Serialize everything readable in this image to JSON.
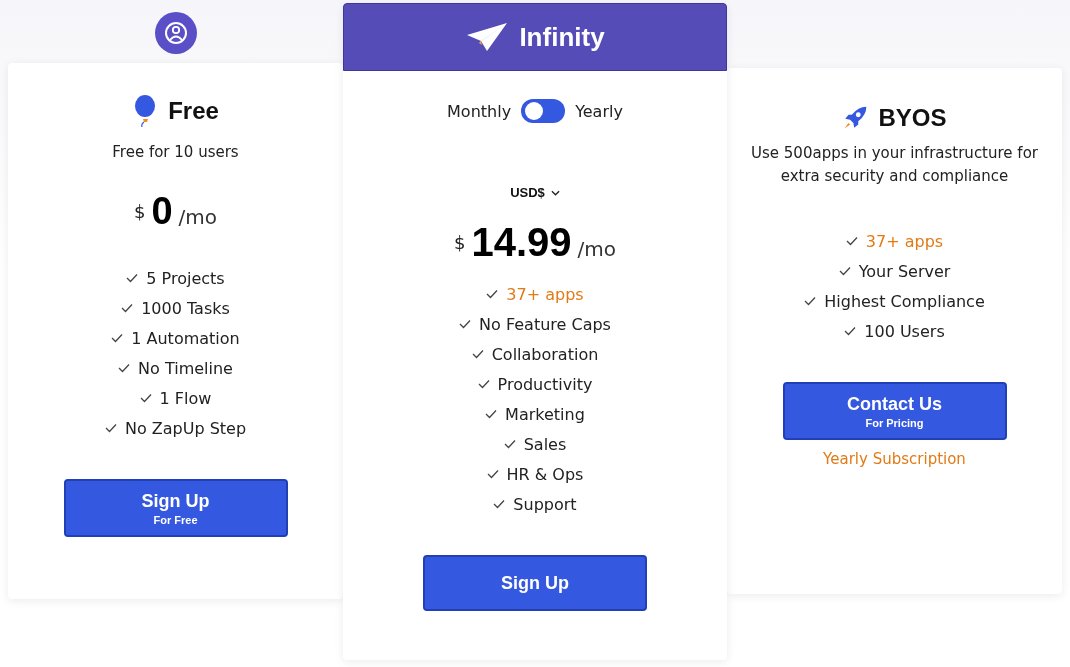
{
  "plans": [
    {
      "kind": "free",
      "name": "Free",
      "subtitle": "Free for 10 users",
      "currency_symbol": "$",
      "price": "0",
      "period": "/mo",
      "features": [
        {
          "text": "5 Projects",
          "highlighted": false
        },
        {
          "text": "1000 Tasks",
          "highlighted": false
        },
        {
          "text": "1 Automation",
          "highlighted": false
        },
        {
          "text": "No Timeline",
          "highlighted": false
        },
        {
          "text": "1 Flow",
          "highlighted": false
        },
        {
          "text": "No ZapUp Step",
          "highlighted": false
        }
      ],
      "button": {
        "label": "Sign Up",
        "sublabel": "For Free"
      }
    },
    {
      "kind": "infinity",
      "name": "Infinity",
      "toggle": {
        "left_label": "Monthly",
        "right_label": "Yearly",
        "on": false
      },
      "currency_select": "USD$",
      "currency_symbol": "$",
      "price": "14.99",
      "period": "/mo",
      "features": [
        {
          "text": "37+ apps",
          "highlighted": true
        },
        {
          "text": "No Feature Caps",
          "highlighted": false
        },
        {
          "text": "Collaboration",
          "highlighted": false
        },
        {
          "text": "Productivity",
          "highlighted": false
        },
        {
          "text": "Marketing",
          "highlighted": false
        },
        {
          "text": "Sales",
          "highlighted": false
        },
        {
          "text": "HR & Ops",
          "highlighted": false
        },
        {
          "text": "Support",
          "highlighted": false
        }
      ],
      "button": {
        "label": "Sign Up"
      }
    },
    {
      "kind": "byos",
      "name": "BYOS",
      "subtitle": "Use 500apps in your infrastructure for extra security and compliance",
      "features": [
        {
          "text": "37+ apps",
          "highlighted": true
        },
        {
          "text": "Your Server",
          "highlighted": false
        },
        {
          "text": "Highest Compliance",
          "highlighted": false
        },
        {
          "text": "100 Users",
          "highlighted": false
        }
      ],
      "button": {
        "label": "Contact Us",
        "sublabel": "For Pricing"
      },
      "link": "Yearly Subscription"
    }
  ]
}
